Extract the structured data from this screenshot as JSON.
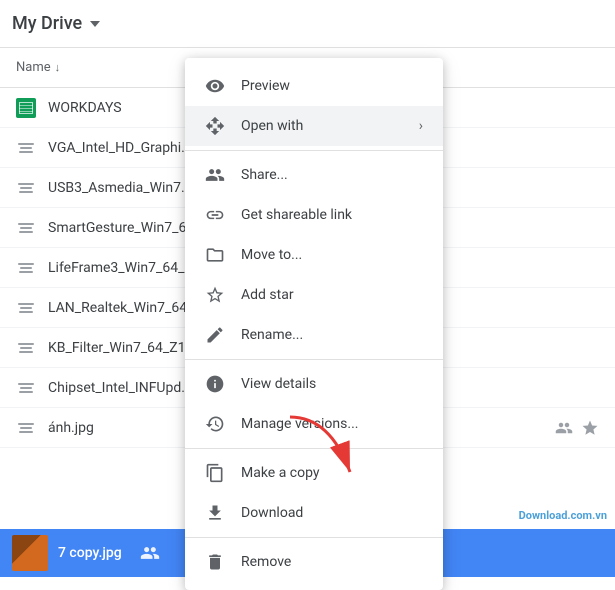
{
  "header": {
    "title": "My Drive",
    "chevron_label": "dropdown"
  },
  "list": {
    "column_name": "Name",
    "sort_indicator": "↓",
    "files": [
      {
        "id": "workdays",
        "name": "WORKDAYS",
        "type": "sheets"
      },
      {
        "id": "vga",
        "name": "VGA_Intel_HD_Graphi...",
        "type": "generic"
      },
      {
        "id": "usb3",
        "name": "USB3_Asmedia_Win7...",
        "type": "generic"
      },
      {
        "id": "smartgesture",
        "name": "SmartGesture_Win7_6...",
        "type": "generic"
      },
      {
        "id": "lifeframe",
        "name": "LifeFrame3_Win7_64_...",
        "type": "generic"
      },
      {
        "id": "lan",
        "name": "LAN_Realtek_Win7_64...",
        "type": "generic"
      },
      {
        "id": "kb",
        "name": "KB_Filter_Win7_64_Z1...",
        "type": "generic"
      },
      {
        "id": "chipset",
        "name": "Chipset_Intel_INFUpd...",
        "type": "generic"
      },
      {
        "id": "anh",
        "name": "ánh.jpg",
        "type": "image",
        "has_people": true,
        "has_star": true
      }
    ]
  },
  "context_menu": {
    "items": [
      {
        "id": "preview",
        "label": "Preview",
        "icon": "eye"
      },
      {
        "id": "open-with",
        "label": "Open with",
        "icon": "open-with",
        "has_arrow": true
      },
      {
        "id": "share",
        "label": "Share...",
        "icon": "share"
      },
      {
        "id": "shareable-link",
        "label": "Get shareable link",
        "icon": "link"
      },
      {
        "id": "move-to",
        "label": "Move to...",
        "icon": "move"
      },
      {
        "id": "add-star",
        "label": "Add star",
        "icon": "star"
      },
      {
        "id": "rename",
        "label": "Rename...",
        "icon": "pencil"
      },
      {
        "id": "view-details",
        "label": "View details",
        "icon": "info"
      },
      {
        "id": "manage-versions",
        "label": "Manage versions...",
        "icon": "clock"
      },
      {
        "id": "make-copy",
        "label": "Make a copy",
        "icon": "copy"
      },
      {
        "id": "download",
        "label": "Download",
        "icon": "download"
      },
      {
        "id": "remove",
        "label": "Remove",
        "icon": "trash"
      }
    ]
  },
  "bottom_bar": {
    "filename": "7 copy.jpg",
    "has_people": true
  },
  "watermark": "Download.com.vn"
}
